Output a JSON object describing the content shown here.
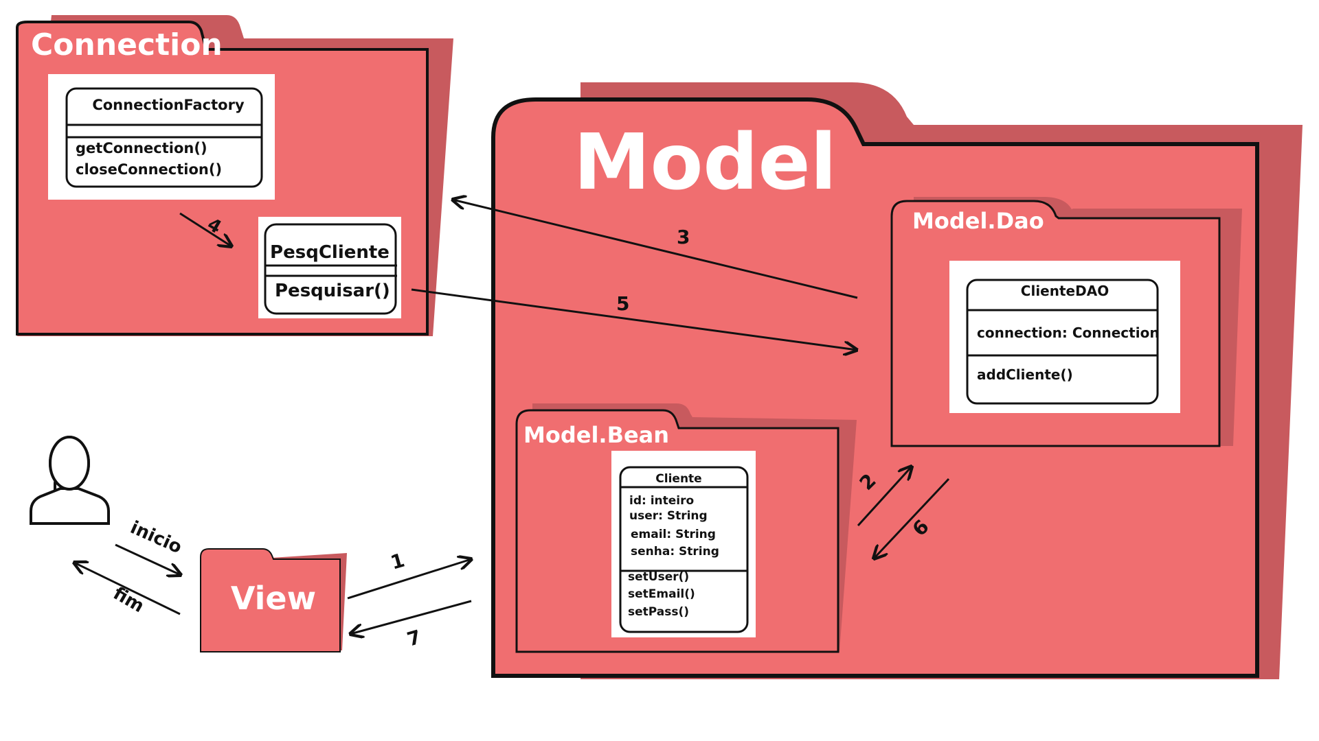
{
  "colors": {
    "folder_fill": "#f06e70",
    "folder_shadow": "#c85a5e",
    "stroke": "#111111",
    "title": "#ffffff"
  },
  "packages": {
    "connection": {
      "title": "Connection"
    },
    "model": {
      "title": "Model"
    },
    "model_dao": {
      "title": "Model.Dao"
    },
    "model_bean": {
      "title": "Model.Bean"
    },
    "view": {
      "title": "View"
    }
  },
  "classes": {
    "connection_factory": {
      "name": "ConnectionFactory",
      "methods": [
        "getConnection()",
        "closeConnection()"
      ]
    },
    "pesq_cliente": {
      "name": "PesqCliente",
      "methods": [
        "Pesquisar()"
      ]
    },
    "cliente_dao": {
      "name": "ClienteDAO",
      "attributes": [
        "connection: Connection"
      ],
      "methods": [
        "addCliente()"
      ]
    },
    "cliente": {
      "name": "Cliente",
      "attributes": [
        "id: inteiro",
        "user: String",
        "email: String",
        "senha: String"
      ],
      "methods": [
        "setUser()",
        "setEmail()",
        "setPass()"
      ]
    }
  },
  "actor": {
    "icon": "user-icon"
  },
  "arrows": {
    "inicio": "inicio",
    "fim": "fim",
    "step1": "1",
    "step2": "2",
    "step3": "3",
    "step4": "4",
    "step5": "5",
    "step6": "6",
    "step7": "7"
  }
}
